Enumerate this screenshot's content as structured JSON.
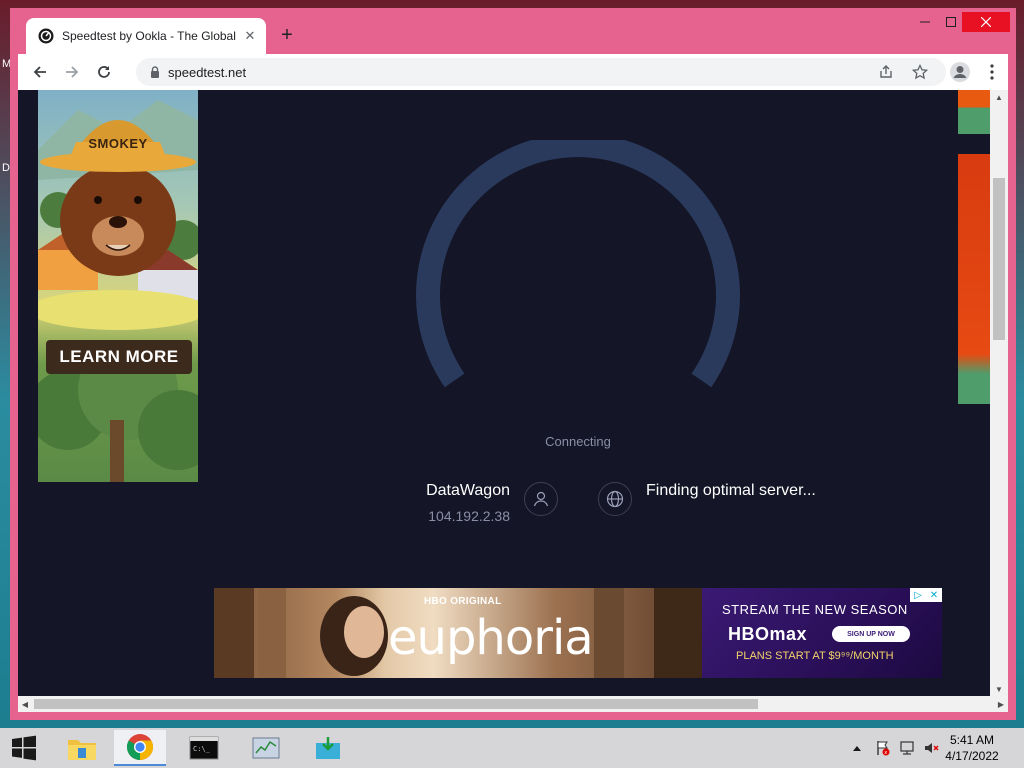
{
  "desktop": {
    "icon_labels": [
      "M",
      "D"
    ]
  },
  "browser": {
    "tab": {
      "title": "Speedtest by Ookla - The Global"
    },
    "url": "speedtest.net"
  },
  "ads": {
    "left": {
      "hat_text": "SMOKEY",
      "cta": "LEARN MORE"
    },
    "bottom": {
      "brand": "HBO ORIGINAL",
      "show": "euphoria",
      "headline": "STREAM THE NEW SEASON",
      "logo": "HBOmax",
      "signup": "SIGN UP NOW",
      "plans": "PLANS START AT $9⁹⁹/MONTH"
    }
  },
  "speedtest": {
    "status": "Connecting",
    "isp": {
      "name": "DataWagon",
      "ip": "104.192.2.38"
    },
    "server": "Finding optimal server..."
  },
  "taskbar": {
    "time": "5:41 AM",
    "date": "4/17/2022"
  },
  "colors": {
    "page_bg": "#141526",
    "gauge_track": "#2a3a5c",
    "window_frame": "#e7638f"
  }
}
